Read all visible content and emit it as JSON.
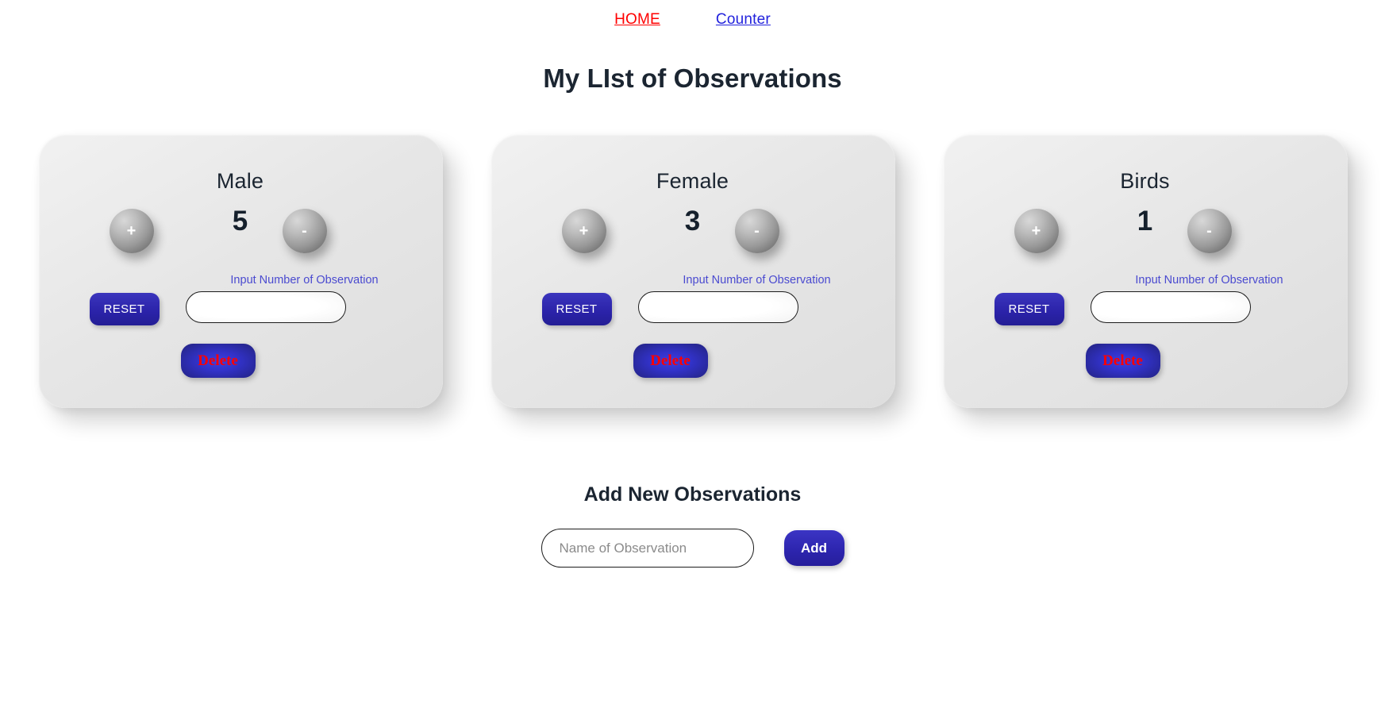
{
  "nav": {
    "links": [
      {
        "label": "HOME",
        "state": "active"
      },
      {
        "label": "Counter",
        "state": "inactive"
      }
    ],
    "active_color": "#ff0000",
    "inactive_color": "#2222dd"
  },
  "page": {
    "title": "My LIst of Observations"
  },
  "cards": [
    {
      "title": "Male",
      "value": "5",
      "increment_label": "+",
      "decrement_label": "-",
      "reset_label": "RESET",
      "input_label": "Input Number of Observation",
      "input_value": "",
      "input_placeholder": "",
      "delete_label": "Delete"
    },
    {
      "title": "Female",
      "value": "3",
      "increment_label": "+",
      "decrement_label": "-",
      "reset_label": "RESET",
      "input_label": "Input Number of Observation",
      "input_value": "",
      "input_placeholder": "",
      "delete_label": "Delete"
    },
    {
      "title": "Birds",
      "value": "1",
      "increment_label": "+",
      "decrement_label": "-",
      "reset_label": "RESET",
      "input_label": "Input Number of Observation",
      "input_value": "",
      "input_placeholder": "",
      "delete_label": "Delete"
    }
  ],
  "add_section": {
    "title": "Add New Observations",
    "input_value": "",
    "input_placeholder": "Name of Observation",
    "button_label": "Add"
  },
  "colors": {
    "accent_blue": "#2a22a8",
    "delete_red": "#ff0000",
    "label_indigo": "#4a4ad0",
    "card_bg": "#e6e6e6",
    "text_dark": "#1b2531"
  }
}
